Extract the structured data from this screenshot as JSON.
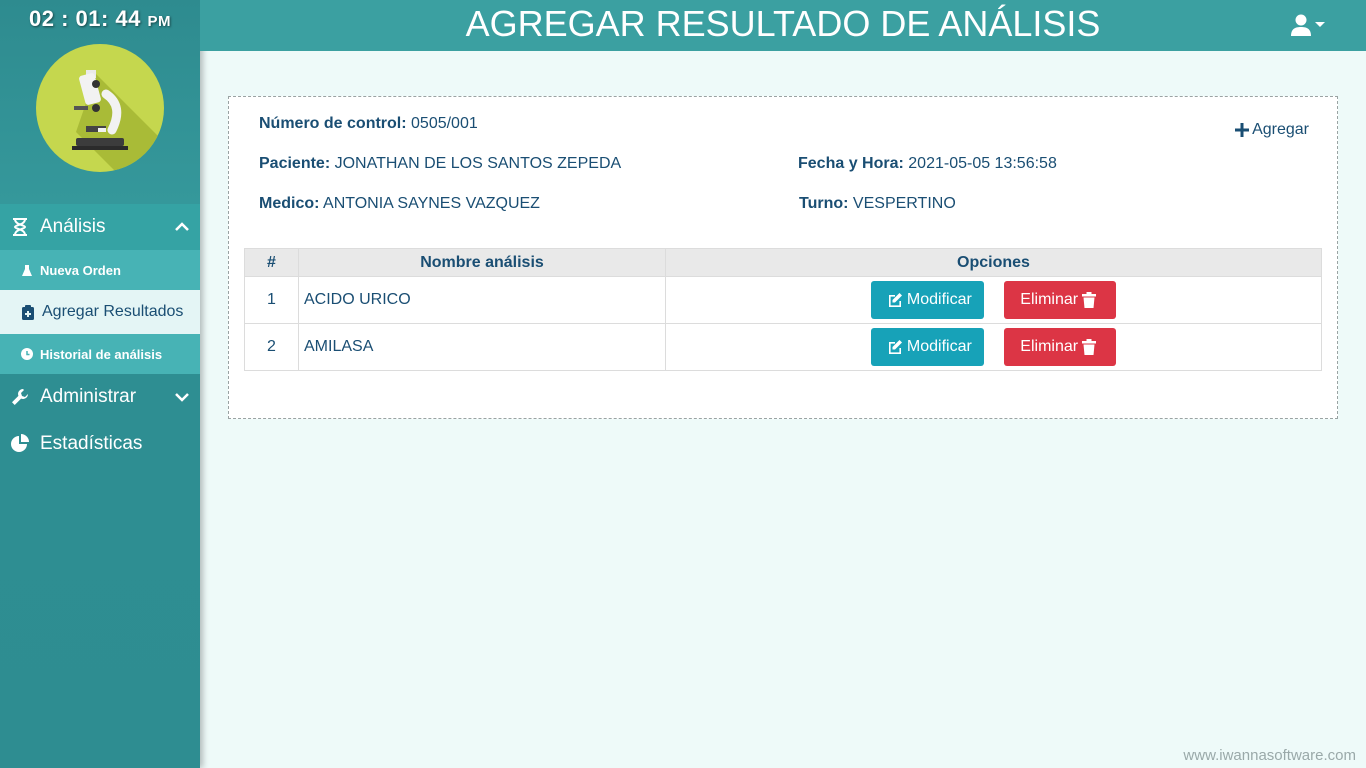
{
  "clock": {
    "time": "02 : 01: 44",
    "ampm": "PM"
  },
  "header": {
    "title": "AGREGAR RESULTADO DE ANÁLISIS"
  },
  "sidebar": {
    "analisis": {
      "label": "Análisis"
    },
    "items": [
      {
        "label": "Nueva Orden"
      },
      {
        "label": "Agregar Resultados"
      },
      {
        "label": "Historial de análisis"
      }
    ],
    "administrar": {
      "label": "Administrar"
    },
    "estadisticas": {
      "label": "Estadísticas"
    }
  },
  "card": {
    "control_label": "Número de control:",
    "control_value": "0505/001",
    "paciente_label": "Paciente:",
    "paciente_value": "JONATHAN DE LOS SANTOS ZEPEDA",
    "fecha_label": "Fecha y Hora:",
    "fecha_value": "2021-05-05 13:56:58",
    "medico_label": "Medico:",
    "medico_value": "ANTONIA SAYNES VAZQUEZ",
    "turno_label": "Turno:",
    "turno_value": "VESPERTINO",
    "add_label": "Agregar"
  },
  "table": {
    "headers": [
      "#",
      "Nombre análisis",
      "Opciones"
    ],
    "rows": [
      {
        "num": "1",
        "name": "ACIDO URICO"
      },
      {
        "num": "2",
        "name": "AMILASA"
      }
    ],
    "modify_label": "Modificar",
    "delete_label": "Eliminar"
  },
  "footer": {
    "text": "www.iwannasoftware.com"
  },
  "colors": {
    "sidebar": "#2f8f93",
    "topbar": "#3ba0a1",
    "active_item": "#e4f5f5",
    "info": "#17a2b8",
    "danger": "#dc3545",
    "text": "#1a4e73"
  }
}
